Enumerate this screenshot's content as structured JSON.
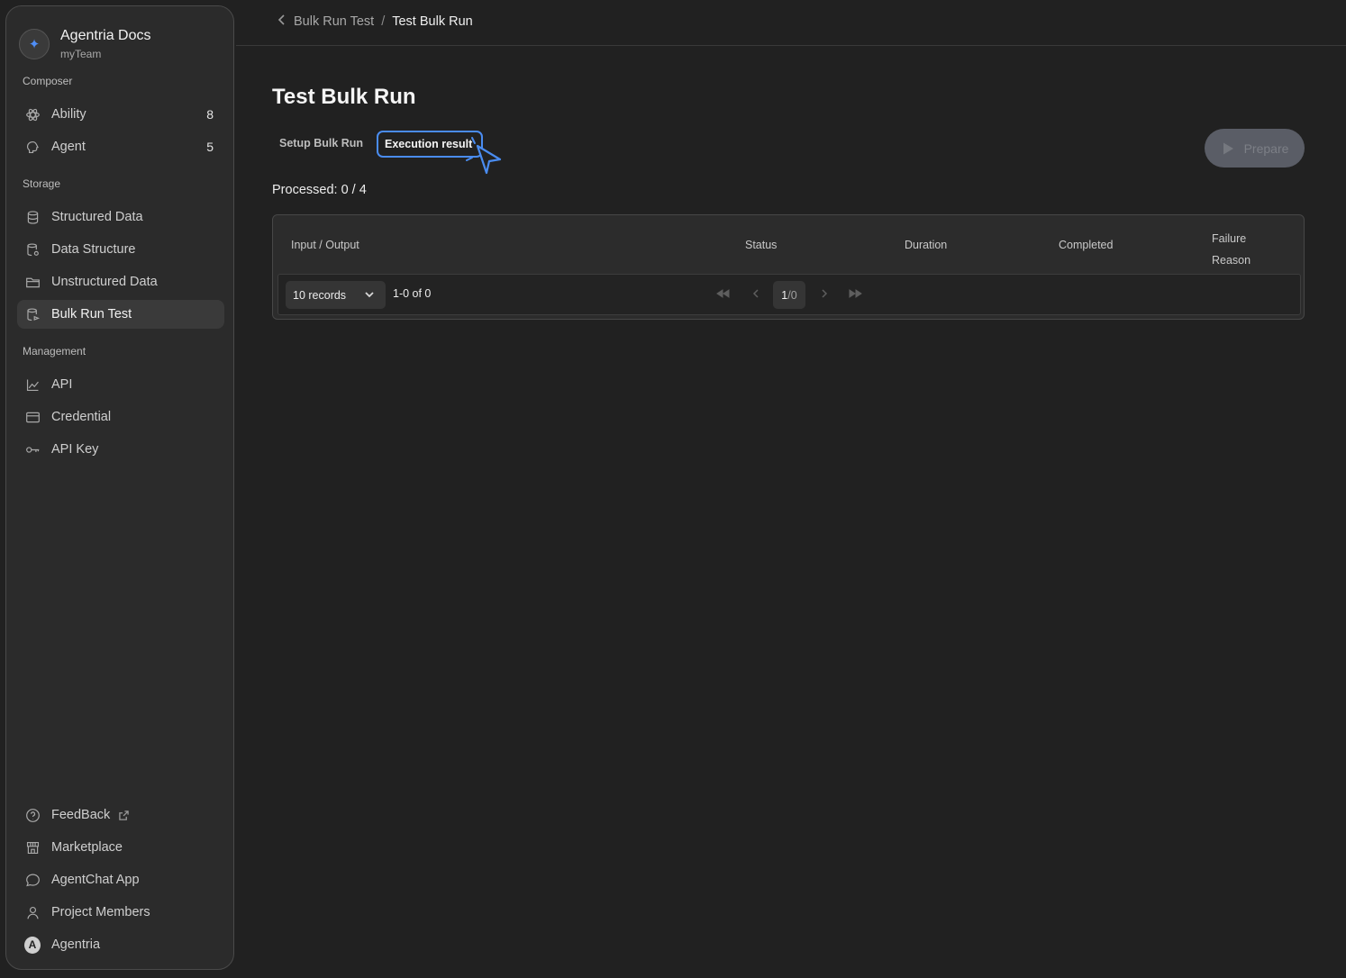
{
  "sidebar": {
    "brand": {
      "title": "Agentria Docs",
      "subtitle": "myTeam"
    },
    "sections": {
      "composer": "Composer",
      "storage": "Storage",
      "management": "Management"
    },
    "items": {
      "ability": {
        "label": "Ability",
        "count": "8"
      },
      "agent": {
        "label": "Agent",
        "count": "5"
      },
      "structured_data": {
        "label": "Structured Data"
      },
      "data_structure": {
        "label": "Data Structure"
      },
      "unstructured_data": {
        "label": "Unstructured Data"
      },
      "bulk_run_test": {
        "label": "Bulk Run Test"
      },
      "api": {
        "label": "API"
      },
      "credential": {
        "label": "Credential"
      },
      "api_key": {
        "label": "API Key"
      }
    },
    "bottom": {
      "feedback": "FeedBack",
      "marketplace": "Marketplace",
      "agentchat": "AgentChat App",
      "members": "Project Members",
      "user": "Agentria",
      "user_initial": "A"
    }
  },
  "breadcrumb": {
    "parent": "Bulk Run Test",
    "separator": "/",
    "current": "Test Bulk Run"
  },
  "page": {
    "title": "Test Bulk Run",
    "tabs": {
      "setup": "Setup Bulk Run",
      "execution": "Execution result"
    },
    "prepare_label": "Prepare",
    "processed": "Processed: 0 / 4"
  },
  "table": {
    "columns": {
      "io": "Input / Output",
      "status": "Status",
      "duration": "Duration",
      "completed": "Completed",
      "failure": "Failure Reason"
    },
    "pager": {
      "records": "10 records",
      "range": "1-0 of 0",
      "current_page": "1",
      "total_pages": "/0"
    }
  },
  "colors": {
    "accent": "#4a8cf0",
    "background": "#212121",
    "sidebar": "#2b2b2b"
  }
}
